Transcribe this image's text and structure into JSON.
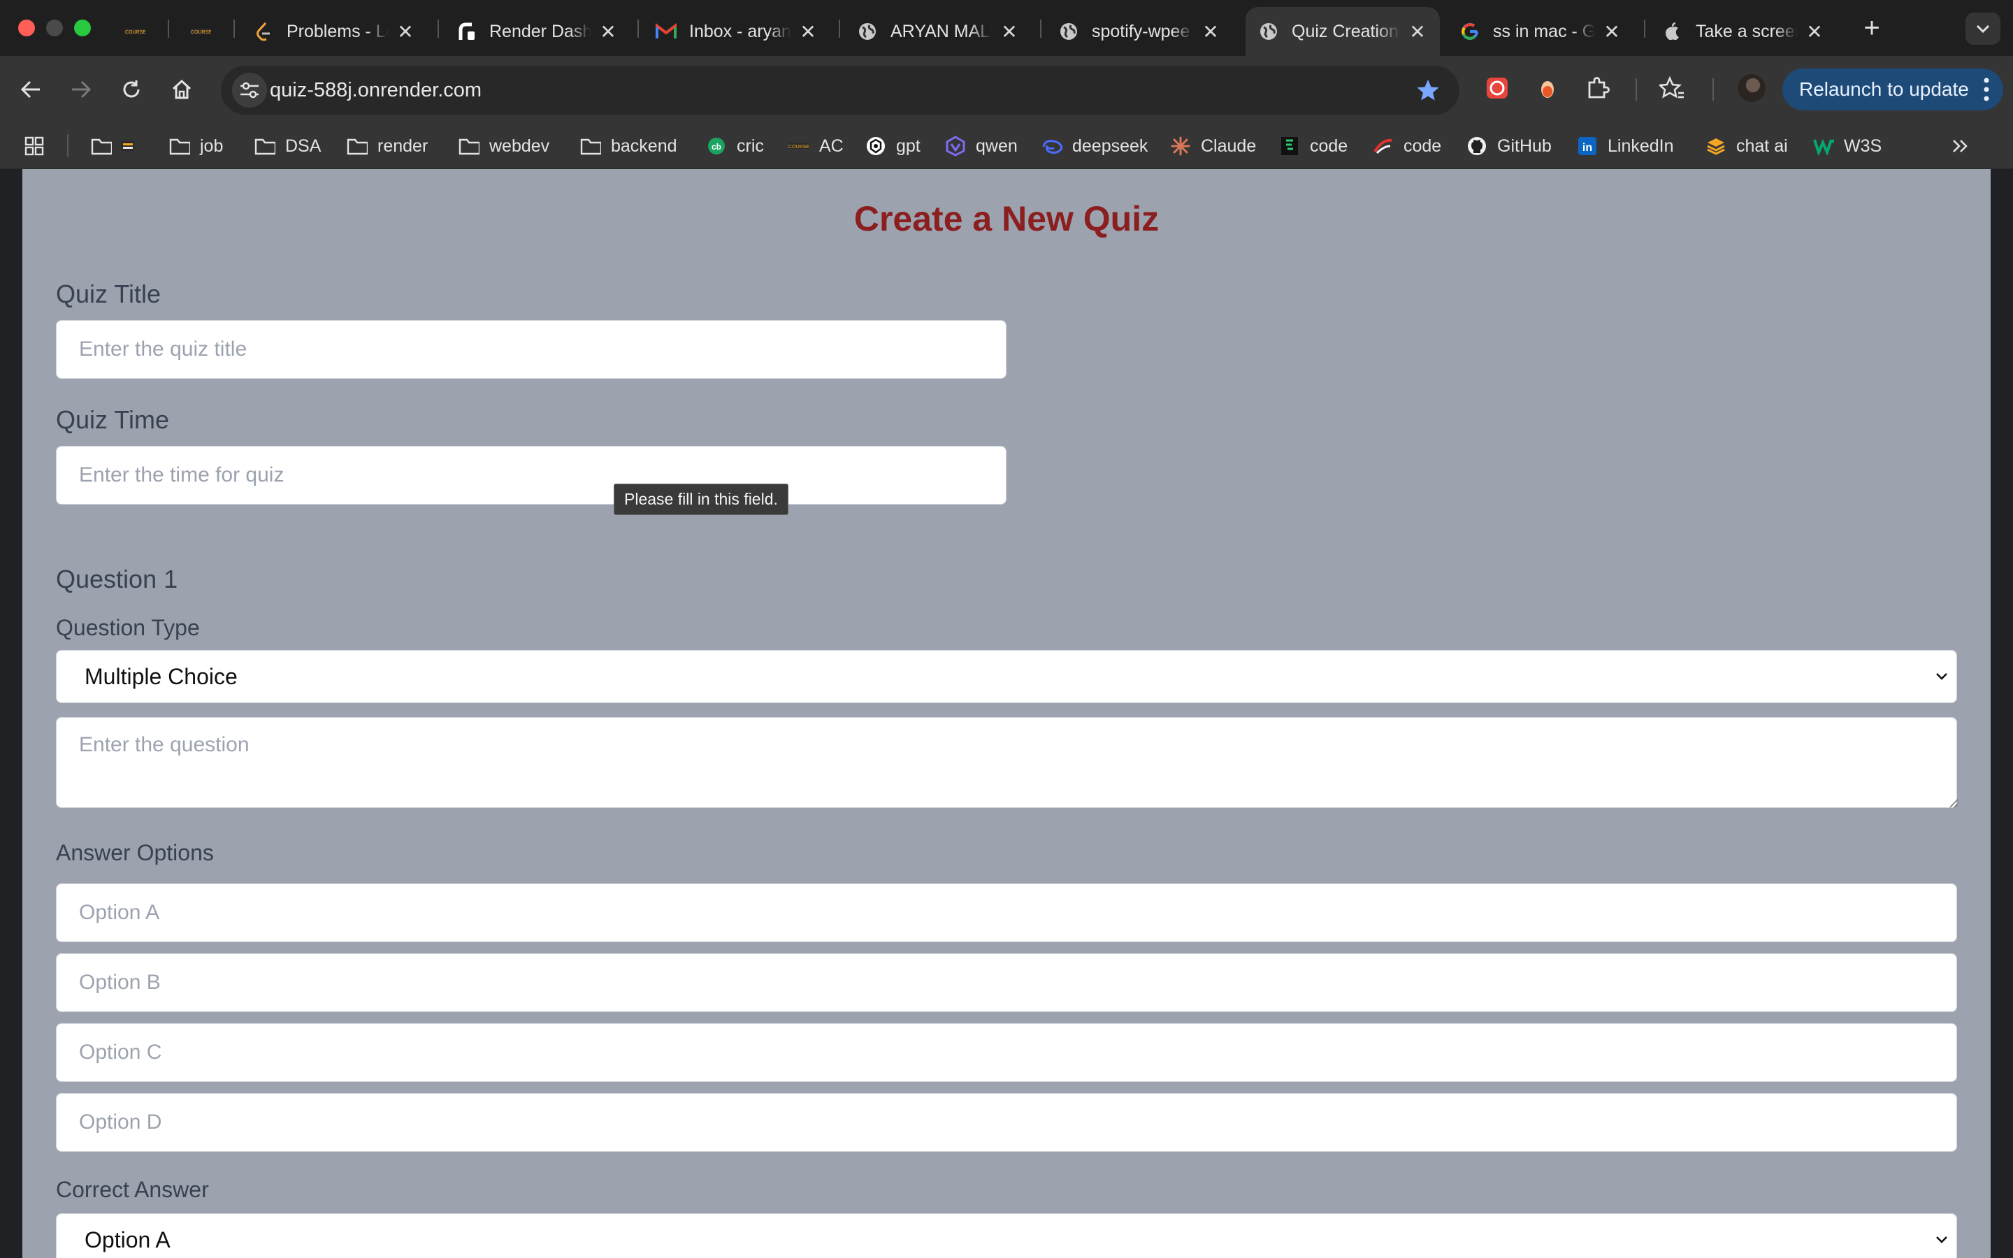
{
  "browser": {
    "tabs": [
      {
        "title": "",
        "favicon": "coursera-logo-icon",
        "active": false
      },
      {
        "title": "",
        "favicon": "coursera-logo-icon",
        "active": false
      },
      {
        "title": "Problems - LeetCode",
        "favicon": "leetcode-icon",
        "active": false
      },
      {
        "title": "Render Dashboard",
        "favicon": "render-icon",
        "active": false
      },
      {
        "title": "Inbox - aryan",
        "favicon": "gmail-icon",
        "active": false
      },
      {
        "title": "ARYAN MALIK",
        "favicon": "globe-icon",
        "active": false
      },
      {
        "title": "spotify-wpee",
        "favicon": "globe-icon",
        "active": false
      },
      {
        "title": "Quiz Creation",
        "favicon": "globe-icon",
        "active": true
      },
      {
        "title": "ss in mac - Google",
        "favicon": "google-icon",
        "active": false
      },
      {
        "title": "Take a screenshot",
        "favicon": "apple-icon",
        "active": false
      }
    ],
    "url": "quiz-588j.onrender.com",
    "relaunch_label": "Relaunch to update",
    "bookmarks": [
      {
        "label": "",
        "icon": "folder-icon"
      },
      {
        "label": "job",
        "icon": "folder-icon"
      },
      {
        "label": "DSA",
        "icon": "folder-icon"
      },
      {
        "label": "render",
        "icon": "folder-icon"
      },
      {
        "label": "webdev",
        "icon": "folder-icon"
      },
      {
        "label": "backend",
        "icon": "folder-icon"
      },
      {
        "label": "cric",
        "icon": "cricbuzz-icon"
      },
      {
        "label": "AC",
        "icon": "coursera-logo-icon"
      },
      {
        "label": "gpt",
        "icon": "openai-icon"
      },
      {
        "label": "qwen",
        "icon": "qwen-icon"
      },
      {
        "label": "deepseek",
        "icon": "deepseek-icon"
      },
      {
        "label": "Claude",
        "icon": "claude-icon"
      },
      {
        "label": "code",
        "icon": "code-icon"
      },
      {
        "label": "code",
        "icon": "code-icon"
      },
      {
        "label": "GitHub",
        "icon": "github-icon"
      },
      {
        "label": "LinkedIn",
        "icon": "linkedin-icon"
      },
      {
        "label": "chat ai",
        "icon": "chat-ai-icon"
      },
      {
        "label": "W3S",
        "icon": "w3schools-icon"
      }
    ]
  },
  "page": {
    "heading": "Create a New Quiz",
    "quiz_title_label": "Quiz Title",
    "quiz_title_placeholder": "Enter the quiz title",
    "quiz_time_label": "Quiz Time",
    "quiz_time_placeholder": "Enter the time for quiz",
    "validation_tooltip": "Please fill in this field.",
    "question_heading": "Question 1",
    "question_type_label": "Question Type",
    "question_type_value": "Multiple Choice",
    "question_placeholder": "Enter the question",
    "answer_options_label": "Answer Options",
    "options": [
      "Option A",
      "Option B",
      "Option C",
      "Option D"
    ],
    "correct_answer_label": "Correct Answer",
    "correct_answer_value": "Option A"
  },
  "colors": {
    "heading": "#8b1e1e",
    "card_background": "#9ca3af",
    "relaunch_button": "#1d4a76",
    "bookmark_star": "#7aa7ff"
  }
}
